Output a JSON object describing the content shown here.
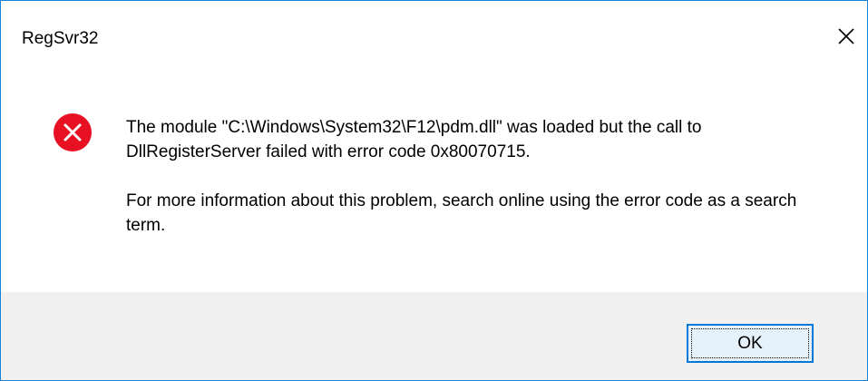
{
  "window": {
    "title": "RegSvr32"
  },
  "icons": {
    "close": "close-icon",
    "error": "error-icon",
    "error_color": "#e81123"
  },
  "message": {
    "line1": "The module \"C:\\Windows\\System32\\F12\\pdm.dll\" was loaded but the call to DllRegisterServer failed with error code 0x80070715.",
    "line2": "For more information about this problem, search online using the error code as a search term."
  },
  "buttons": {
    "ok_label": "OK"
  },
  "colors": {
    "accent": "#0078d7",
    "window_border": "#1883d7",
    "footer_bg": "#f0f0f0"
  }
}
